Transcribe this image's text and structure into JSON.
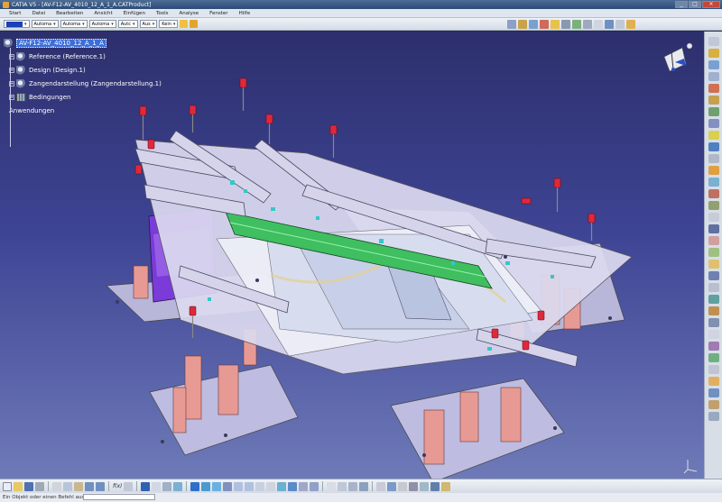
{
  "window": {
    "title": "CATIA V5 - [AV-F12-AV_4010_12_A_1_A.CATProduct]",
    "controls": [
      "_",
      "□",
      "×"
    ]
  },
  "menu": [
    "Start",
    "Datei",
    "Bearbeiten",
    "Ansicht",
    "Einfügen",
    "Tools",
    "Analyse",
    "Fenster",
    "Hilfe"
  ],
  "toolbar": {
    "combo_automatic": "Automa",
    "combo_layer1": "Automa",
    "combo_layer2": "Automa",
    "combo_filter": "Autc",
    "combo_line": "Aus",
    "combo_none": "Kein",
    "accent_color": "#1a3fb8"
  },
  "tree": {
    "root": "AV-F12-AV_4010_12_A_1_A",
    "children": [
      {
        "label": "Reference (Reference.1)",
        "icon": "product-icon"
      },
      {
        "label": "Design (Design.1)",
        "icon": "product-icon"
      },
      {
        "label": "Zangendarstellung (Zangendarstellung.1)",
        "icon": "product-icon"
      },
      {
        "label": "Bedingungen",
        "icon": "constraints-icon"
      }
    ],
    "applications": "Anwendungen"
  },
  "bottom": {
    "fx_label": "f(x)"
  },
  "status": {
    "message": "Ein Objekt oder einen Befehl auswählen"
  }
}
